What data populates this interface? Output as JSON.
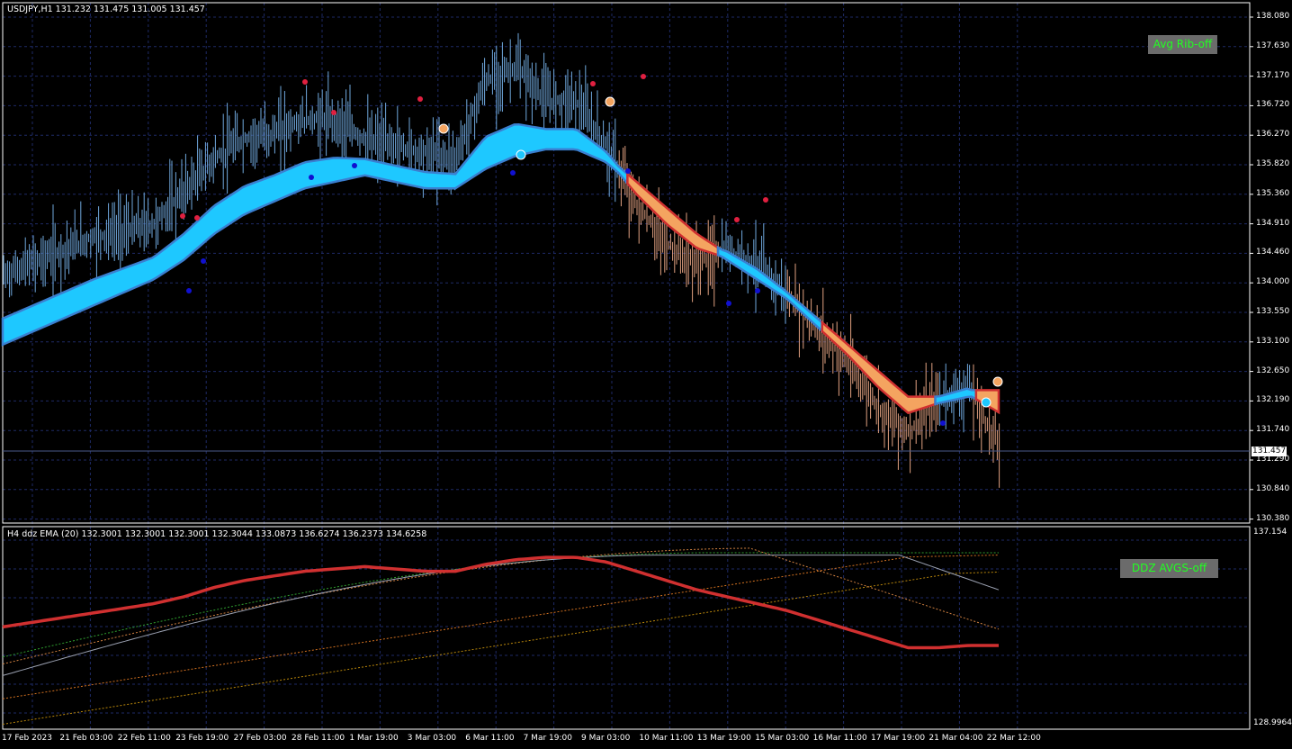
{
  "main_panel": {
    "title": "USDJPY,H1  131.232 131.475 131.005 131.457",
    "button": "Avg Rib-off",
    "price_axis": [
      "138.080",
      "137.630",
      "137.170",
      "136.720",
      "136.270",
      "135.820",
      "135.360",
      "134.910",
      "134.460",
      "134.000",
      "133.550",
      "133.100",
      "132.650",
      "132.190",
      "131.740",
      "131.290",
      "130.840",
      "130.380"
    ],
    "current_price": "131.457"
  },
  "sub_panel": {
    "title": "H4 ddz EMA (20) 132.3001 132.3001 132.3001 132.3044 133.0873 136.6274 136.2373 134.6258",
    "button": "DDZ AVGS-off",
    "axis_top": "137.154",
    "axis_bottom": "128.9964"
  },
  "time_axis": [
    "17 Feb 2023",
    "21 Feb 03:00",
    "22 Feb 11:00",
    "23 Feb 19:00",
    "27 Feb 03:00",
    "28 Feb 11:00",
    "1 Mar 19:00",
    "3 Mar 03:00",
    "6 Mar 11:00",
    "7 Mar 19:00",
    "9 Mar 03:00",
    "10 Mar 11:00",
    "13 Mar 19:00",
    "15 Mar 03:00",
    "16 Mar 11:00",
    "17 Mar 19:00",
    "21 Mar 04:00",
    "22 Mar 12:00"
  ],
  "colors": {
    "bullish": "#6fa8dc",
    "bearish": "#e0a080",
    "ribbon_up": "#1ec8ff",
    "ribbon_down": "#f4a460",
    "grid": "#1e2a66"
  },
  "chart_data": {
    "type": "line",
    "series": [
      {
        "values": [
          134.1,
          134.3,
          134.5,
          134.7,
          134.8,
          134.9,
          135.4,
          135.9,
          136.2,
          136.3,
          136.5,
          136.5,
          136.2,
          136.1,
          136.0,
          135.9,
          137.1,
          137.3,
          136.8,
          136.8,
          136.1,
          135.2,
          134.6,
          134.3,
          134.5,
          134.3,
          133.8,
          133.3,
          132.8,
          132.1,
          131.7,
          132.2,
          132.4,
          131.5
        ]
      },
      {
        "values": [
          133.1,
          133.3,
          133.5,
          133.7,
          133.9,
          134.1,
          134.4,
          134.8,
          135.1,
          135.3,
          135.5,
          135.6,
          135.7,
          135.6,
          135.5,
          135.5,
          135.8,
          136.0,
          136.1,
          136.1,
          135.9,
          135.5,
          135.1,
          134.7,
          134.4,
          134.1,
          133.8,
          133.4,
          133.0,
          132.6,
          132.2,
          132.2,
          132.3,
          132.3
        ]
      }
    ]
  }
}
